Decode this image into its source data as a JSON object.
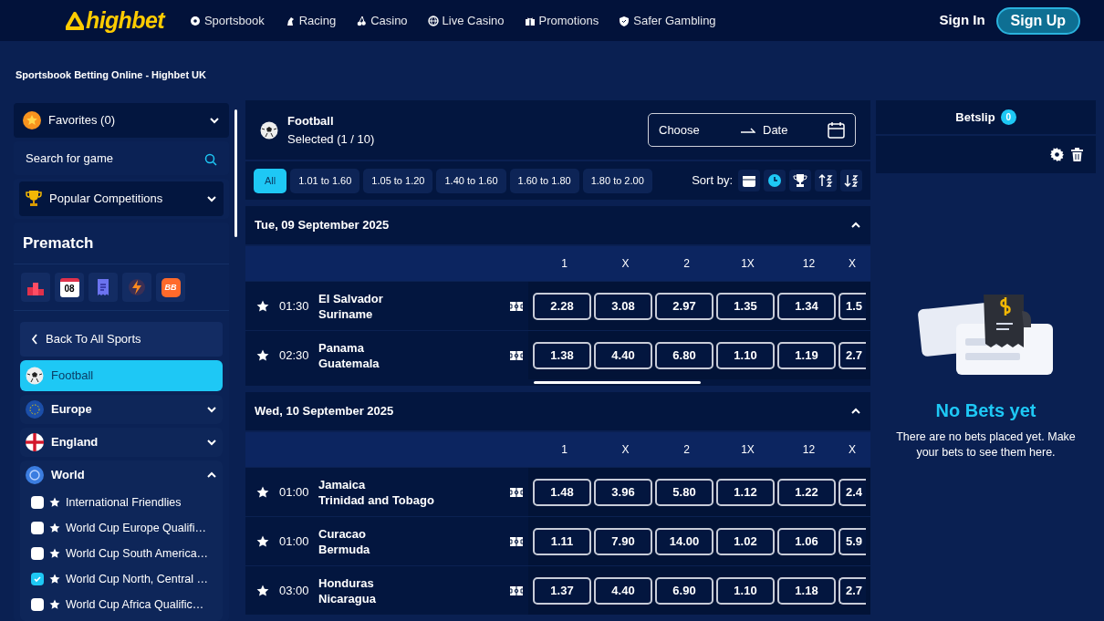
{
  "header": {
    "logo": "highbet",
    "nav": [
      {
        "label": "Sportsbook",
        "kind": "ball"
      },
      {
        "label": "Racing",
        "kind": "horse"
      },
      {
        "label": "Casino",
        "kind": "cherry"
      },
      {
        "label": "Live Casino",
        "kind": "globe"
      },
      {
        "label": "Promotions",
        "kind": "gift"
      },
      {
        "label": "Safer Gambling",
        "kind": "shield"
      }
    ],
    "sign_in": "Sign In",
    "sign_up": "Sign Up"
  },
  "page_title": "Sportsbook Betting Online - Highbet UK",
  "sidebar": {
    "favorites": {
      "label": "Favorites (0)",
      "expanded": false
    },
    "search": {
      "placeholder": "Search for game"
    },
    "popular": {
      "label": "Popular Competitions",
      "expanded": false
    },
    "prematch_title": "Prematch",
    "quick_links": [
      {
        "kind": "podium"
      },
      {
        "kind": "calendar",
        "text": "08"
      },
      {
        "kind": "receipt"
      },
      {
        "kind": "bolt"
      },
      {
        "kind": "tag",
        "text": "BB"
      }
    ],
    "back": "Back To All Sports",
    "sport": {
      "label": "Football",
      "selected": true
    },
    "regions": [
      {
        "label": "Europe",
        "kind": "eu",
        "expanded": false
      },
      {
        "label": "England",
        "kind": "england",
        "expanded": false
      },
      {
        "label": "World",
        "kind": "world",
        "expanded": true,
        "children": [
          {
            "label": "International Friendlies",
            "checked": false
          },
          {
            "label": "World Cup Europe Qualifi…",
            "checked": false
          },
          {
            "label": "World Cup South America…",
            "checked": false
          },
          {
            "label": "World Cup North, Central …",
            "checked": true
          },
          {
            "label": "World Cup Africa Qualific…",
            "checked": false
          }
        ]
      }
    ]
  },
  "main": {
    "sport": "Football",
    "selected_count": "Selected (1 / 10)",
    "date_from": "Choose",
    "date_to": "Date",
    "filters": [
      {
        "label": "All",
        "selected": true
      },
      {
        "label": "1.01 to 1.60",
        "selected": false
      },
      {
        "label": "1.05 to 1.20",
        "selected": false
      },
      {
        "label": "1.40 to 1.60",
        "selected": false
      },
      {
        "label": "1.60 to 1.80",
        "selected": false
      },
      {
        "label": "1.80 to 2.00",
        "selected": false
      }
    ],
    "sort_label": "Sort by:",
    "sort_options": [
      {
        "kind": "calendar",
        "selected": false
      },
      {
        "kind": "clock",
        "selected": true
      },
      {
        "kind": "trophy",
        "selected": false
      },
      {
        "kind": "asc",
        "selected": false
      },
      {
        "kind": "desc",
        "selected": false
      }
    ],
    "groups": [
      {
        "date": "Tue, 09 September 2025",
        "expanded": true,
        "columns": [
          "1",
          "X",
          "2",
          "1X",
          "12",
          "X"
        ],
        "matches": [
          {
            "time": "01:30",
            "home": "El Salvador",
            "away": "Suriname",
            "odds": [
              "2.28",
              "3.08",
              "2.97",
              "1.35",
              "1.34",
              "1.5"
            ]
          },
          {
            "time": "02:30",
            "home": "Panama",
            "away": "Guatemala",
            "odds": [
              "1.38",
              "4.40",
              "6.80",
              "1.10",
              "1.19",
              "2.7"
            ]
          }
        ]
      },
      {
        "date": "Wed, 10 September 2025",
        "expanded": true,
        "columns": [
          "1",
          "X",
          "2",
          "1X",
          "12",
          "X"
        ],
        "matches": [
          {
            "time": "01:00",
            "home": "Jamaica",
            "away": "Trinidad and Tobago",
            "odds": [
              "1.48",
              "3.96",
              "5.80",
              "1.12",
              "1.22",
              "2.4"
            ]
          },
          {
            "time": "01:00",
            "home": "Curacao",
            "away": "Bermuda",
            "odds": [
              "1.11",
              "7.90",
              "14.00",
              "1.02",
              "1.06",
              "5.9"
            ]
          },
          {
            "time": "03:00",
            "home": "Honduras",
            "away": "Nicaragua",
            "odds": [
              "1.37",
              "4.40",
              "6.90",
              "1.10",
              "1.18",
              "2.7"
            ]
          }
        ]
      }
    ]
  },
  "betslip": {
    "title": "Betslip",
    "count": "0",
    "empty_title": "No Bets yet",
    "empty_text": "There are no bets placed yet. Make your bets to see them here."
  }
}
